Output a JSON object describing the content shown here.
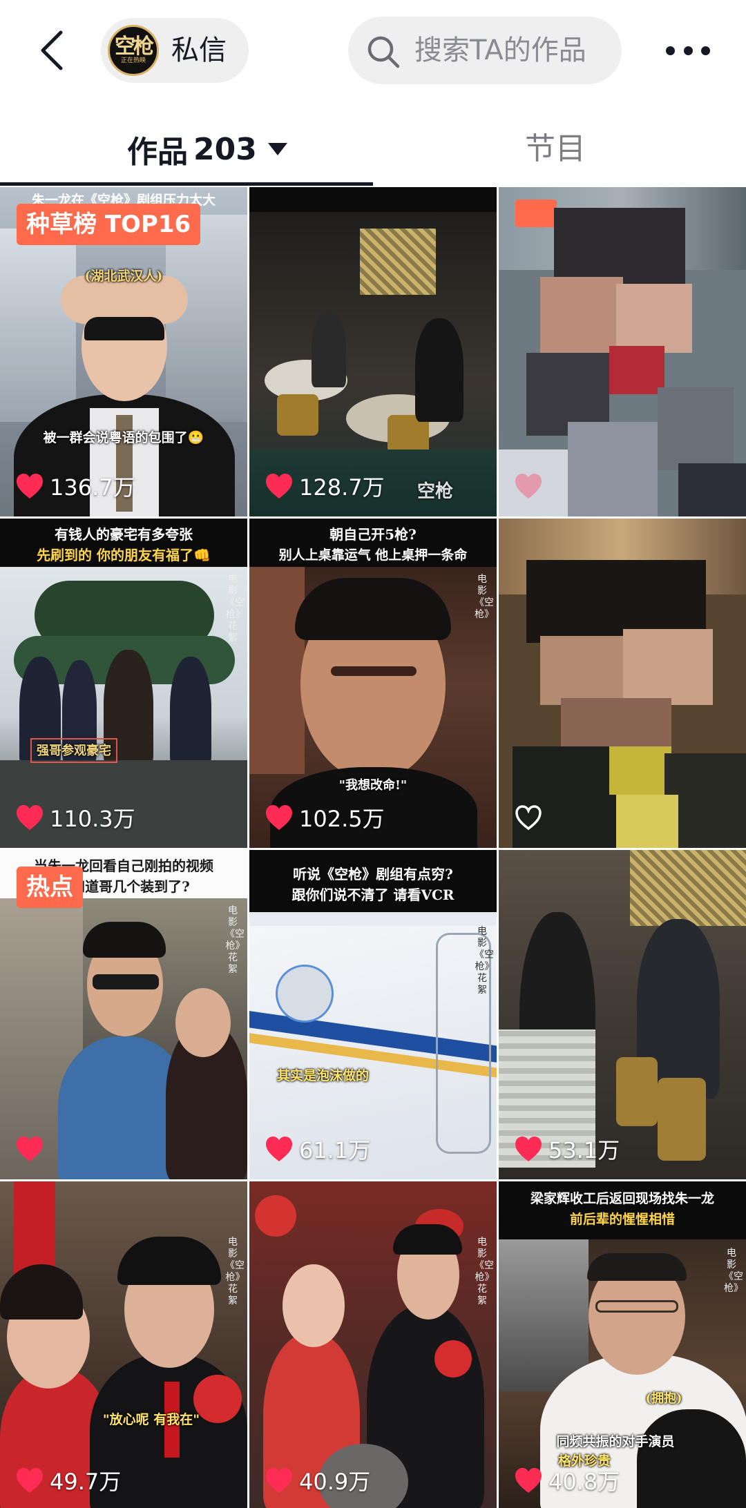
{
  "header": {
    "dm_label": "私信",
    "dm_avatar_text": "空枪",
    "dm_avatar_subtext": "正在热映",
    "search_placeholder": "搜索TA的作品"
  },
  "tabs": {
    "works_label": "作品",
    "works_count": "203",
    "program_label": "节目"
  },
  "grid": {
    "items": [
      {
        "badge": "种草榜 TOP16",
        "caption_line1": "朱一龙在《空枪》剧组压力太大",
        "overlay_1": "(湖北武汉人)",
        "overlay_2": "被一群会说粤语的包围了😬",
        "liked": true,
        "likes": "136.7万"
      },
      {
        "overlay_1": "空枪",
        "liked": true,
        "likes": "128.7万"
      },
      {
        "liked": true,
        "likes": ""
      },
      {
        "caption_line1": "有钱人的豪宅有多夸张",
        "caption_line2": "先刷到的 你的朋友有福了👊",
        "overlay_1": "强哥参观豪宅",
        "side_tag": "电影《空枪》花絮",
        "liked": true,
        "likes": "110.3万"
      },
      {
        "caption_line1": "朝自己开5枪?",
        "caption_line2": "别人上桌靠运气 他上桌押一条命",
        "overlay_1": "\"我想改命!\"",
        "side_tag": "电影《空枪》",
        "liked": true,
        "likes": "102.5万"
      },
      {
        "liked": false,
        "likes": ""
      },
      {
        "badge": "热点",
        "caption_line1": "当朱一龙回看自己刚拍的视频",
        "caption_line2": "才知道哥几个装到了?",
        "side_tag": "电影《空枪》花絮",
        "liked": true,
        "likes": ""
      },
      {
        "caption_line1": "听说《空枪》剧组有点穷?",
        "caption_line2": "跟你们说不清了 请看VCR",
        "overlay_1": "其实是泡沫做的",
        "side_tag": "电影《空枪》花絮",
        "liked": true,
        "likes": "61.1万"
      },
      {
        "liked": true,
        "likes": "53.1万"
      },
      {
        "overlay_1": "\"放心呢 有我在\"",
        "side_tag": "电影《空枪》花絮",
        "liked": true,
        "likes": "49.7万"
      },
      {
        "side_tag": "电影《空枪》花絮",
        "liked": true,
        "likes": "40.9万"
      },
      {
        "caption_line1": "梁家辉收工后返回现场找朱一龙",
        "caption_line2": "前后辈的惺惺相惜",
        "overlay_1": "(拥抱)",
        "overlay_2": "同频共振的对手演员",
        "overlay_3": "格外珍贵",
        "side_tag": "电影《空枪》",
        "liked": true,
        "likes": "40.8万"
      }
    ]
  },
  "colors": {
    "accent_like": "#fe2c55",
    "badge_bg": "#fe6b4c",
    "text_primary": "#161823",
    "text_secondary": "#7d7e83",
    "pill_bg": "#efefef"
  }
}
